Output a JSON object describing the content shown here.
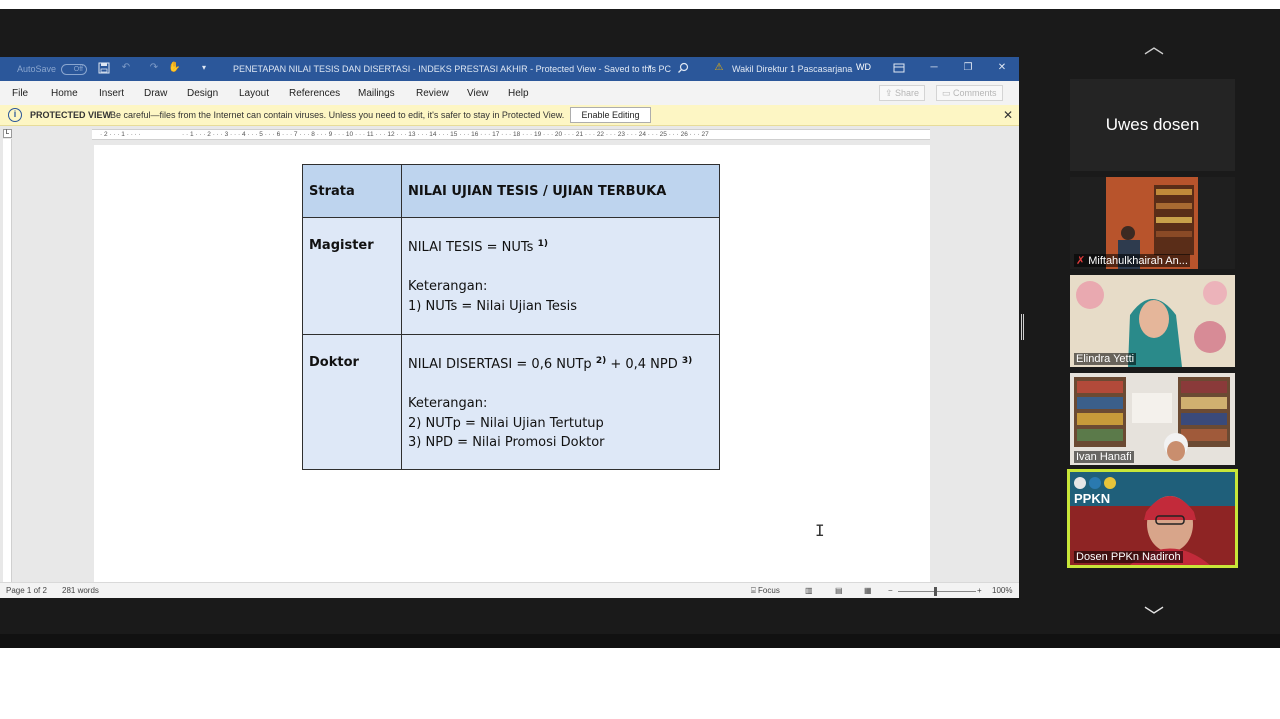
{
  "word": {
    "title": "PENETAPAN NILAI TESIS DAN DISERTASI - INDEKS PRESTASI AKHIR  -  Protected View  -  Saved to this PC",
    "autosave_label": "AutoSave",
    "autosave_state": "Off",
    "user_name": "Wakil Direktur 1 Pascasarjana",
    "user_initials": "WD",
    "menu": [
      "File",
      "Home",
      "Insert",
      "Draw",
      "Design",
      "Layout",
      "References",
      "Mailings",
      "Review",
      "View",
      "Help"
    ],
    "share_label": "Share",
    "comments_label": "Comments",
    "protected_view": {
      "title": "PROTECTED VIEW",
      "message": "Be careful—files from the Internet can contain viruses. Unless you need to edit, it's safer to stay in Protected View.",
      "button": "Enable Editing"
    },
    "status": {
      "page": "Page 1 of 2",
      "words": "281 words",
      "focus": "Focus",
      "zoom": "100%"
    }
  },
  "table": {
    "header": {
      "col1": "Strata",
      "col2": "NILAI UJIAN TESIS / UJIAN TERBUKA"
    },
    "magister": {
      "label": "Magister",
      "formula": "NILAI TESIS = NUTs",
      "formula_sup": "1)",
      "ket": "Keterangan:",
      "note1": "1) NUTs = Nilai Ujian Tesis"
    },
    "doktor": {
      "label": "Doktor",
      "formula_a": "NILAI DISERTASI = 0,6 NUTp",
      "sup_a": "2)",
      "formula_b": " + 0,4 NPD",
      "sup_b": "3)",
      "ket": "Keterangan:",
      "note2": "2) NUTp = Nilai Ujian Tertutup",
      "note3": "3) NPD = Nilai Promosi Doktor"
    }
  },
  "participants": [
    {
      "name": "Uwes dosen"
    },
    {
      "name": "Miftahulkhairah An..."
    },
    {
      "name": "Elindra Yetti"
    },
    {
      "name": "Ivan Hanafi"
    },
    {
      "name": "Dosen PPKn Nadiroh"
    }
  ],
  "nadiroh_background": {
    "brand": "PPKN"
  },
  "colors": {
    "word_blue": "#2b579a",
    "header_fill": "#bed4ee",
    "cell_fill": "#dee8f7",
    "protected_bar": "#fdf6c4",
    "active_speaker_border": "#c8e639"
  },
  "icons": [
    "save-icon",
    "undo-icon",
    "redo-icon",
    "search-icon",
    "warning-icon",
    "ribbon-display-icon",
    "minimize-icon",
    "restore-icon",
    "close-icon",
    "shield-icon",
    "mic-muted-icon",
    "chevron-up-icon",
    "chevron-down-icon"
  ]
}
